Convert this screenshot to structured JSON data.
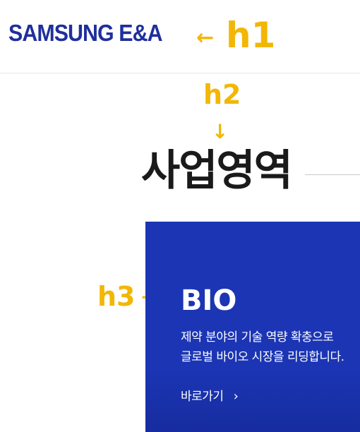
{
  "header": {
    "logo_text": "SAMSUNG E&A"
  },
  "annotations": {
    "h1_arrow": "←",
    "h1": "h1",
    "h2": "h2",
    "h2_arrow": "↓",
    "h3": "h3",
    "h3_arrow": "→"
  },
  "main": {
    "title": "사업영역"
  },
  "bio_card": {
    "title": "BIO",
    "desc_line1": "제약 분야의 기술 역량 확충으로",
    "desc_line2": "글로벌 바이오 시장을 리딩합니다.",
    "link_label": "바로가기",
    "link_icon": "chevron-right-icon"
  },
  "colors": {
    "brand": "#1f2f9c",
    "card_bg": "#1b35b4",
    "annotation": "#f2b705"
  }
}
